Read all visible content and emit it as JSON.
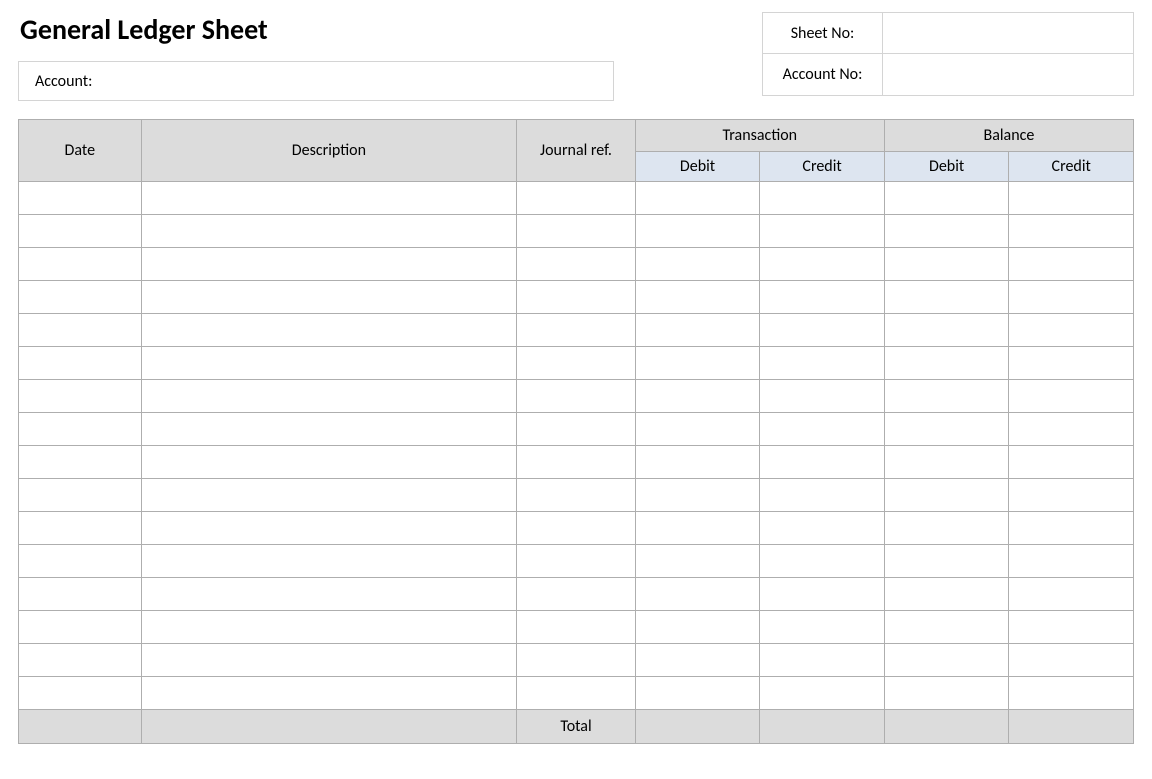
{
  "title": "General Ledger Sheet",
  "header": {
    "account_label": "Account:",
    "account_value": "",
    "sheet_no_label": "Sheet No:",
    "sheet_no_value": "",
    "account_no_label": "Account No:",
    "account_no_value": ""
  },
  "table": {
    "columns": {
      "date": "Date",
      "description": "Description",
      "journal_ref": "Journal ref.",
      "transaction": "Transaction",
      "balance": "Balance",
      "debit": "Debit",
      "credit": "Credit"
    },
    "rows": [
      {
        "date": "",
        "description": "",
        "journal_ref": "",
        "t_debit": "",
        "t_credit": "",
        "b_debit": "",
        "b_credit": ""
      },
      {
        "date": "",
        "description": "",
        "journal_ref": "",
        "t_debit": "",
        "t_credit": "",
        "b_debit": "",
        "b_credit": ""
      },
      {
        "date": "",
        "description": "",
        "journal_ref": "",
        "t_debit": "",
        "t_credit": "",
        "b_debit": "",
        "b_credit": ""
      },
      {
        "date": "",
        "description": "",
        "journal_ref": "",
        "t_debit": "",
        "t_credit": "",
        "b_debit": "",
        "b_credit": ""
      },
      {
        "date": "",
        "description": "",
        "journal_ref": "",
        "t_debit": "",
        "t_credit": "",
        "b_debit": "",
        "b_credit": ""
      },
      {
        "date": "",
        "description": "",
        "journal_ref": "",
        "t_debit": "",
        "t_credit": "",
        "b_debit": "",
        "b_credit": ""
      },
      {
        "date": "",
        "description": "",
        "journal_ref": "",
        "t_debit": "",
        "t_credit": "",
        "b_debit": "",
        "b_credit": ""
      },
      {
        "date": "",
        "description": "",
        "journal_ref": "",
        "t_debit": "",
        "t_credit": "",
        "b_debit": "",
        "b_credit": ""
      },
      {
        "date": "",
        "description": "",
        "journal_ref": "",
        "t_debit": "",
        "t_credit": "",
        "b_debit": "",
        "b_credit": ""
      },
      {
        "date": "",
        "description": "",
        "journal_ref": "",
        "t_debit": "",
        "t_credit": "",
        "b_debit": "",
        "b_credit": ""
      },
      {
        "date": "",
        "description": "",
        "journal_ref": "",
        "t_debit": "",
        "t_credit": "",
        "b_debit": "",
        "b_credit": ""
      },
      {
        "date": "",
        "description": "",
        "journal_ref": "",
        "t_debit": "",
        "t_credit": "",
        "b_debit": "",
        "b_credit": ""
      },
      {
        "date": "",
        "description": "",
        "journal_ref": "",
        "t_debit": "",
        "t_credit": "",
        "b_debit": "",
        "b_credit": ""
      },
      {
        "date": "",
        "description": "",
        "journal_ref": "",
        "t_debit": "",
        "t_credit": "",
        "b_debit": "",
        "b_credit": ""
      },
      {
        "date": "",
        "description": "",
        "journal_ref": "",
        "t_debit": "",
        "t_credit": "",
        "b_debit": "",
        "b_credit": ""
      },
      {
        "date": "",
        "description": "",
        "journal_ref": "",
        "t_debit": "",
        "t_credit": "",
        "b_debit": "",
        "b_credit": ""
      }
    ],
    "footer": {
      "total_label": "Total",
      "t_debit": "",
      "t_credit": "",
      "b_debit": "",
      "b_credit": ""
    }
  }
}
